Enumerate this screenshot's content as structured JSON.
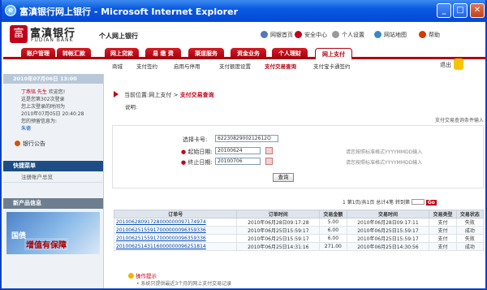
{
  "window": {
    "title": "富滇银行网上银行 - Microsoft Internet Explorer",
    "min": "_",
    "max": "□",
    "close": "✕"
  },
  "header": {
    "logo_cn": "富滇银行",
    "logo_en": "FUDIAN BANK",
    "subtitle": "个人网上银行",
    "links": [
      {
        "label": "网银首页",
        "color": "#5577bb"
      },
      {
        "label": "安全中心",
        "color": "#c1001a"
      },
      {
        "label": "个人设置",
        "color": "#999"
      },
      {
        "label": "网站地图",
        "color": "#3a88c8"
      },
      {
        "label": "帮助",
        "color": "#d43a00"
      }
    ]
  },
  "nav": {
    "tabs": [
      "账户管理",
      "转帐汇款",
      "网上贷款",
      "易 缴 费",
      "渠道服务",
      "资金业务",
      "个人理财",
      "网上支付"
    ],
    "active": 7
  },
  "subnav": {
    "items": [
      "商城",
      "支付签约",
      "启用与停用",
      "支付额度设置",
      "支付交易查询",
      "支付宝卡通签约"
    ],
    "active": 4
  },
  "logout": "退出",
  "sidebar": {
    "date": "2010年07月06日 13:00",
    "user": {
      "name": "丁燕铭 先生",
      "greeting": "欢迎您!",
      "lines": [
        "这是您第302次登录",
        "您上次登录的时间为",
        "2010年07月05日 20:40:28",
        "您的预留信息为:"
      ],
      "reserved": "朱德"
    },
    "notice": "银行公告",
    "menu_title": "快捷菜单",
    "menu_items": [
      "注册账户总览"
    ],
    "news_title": "新产品信息",
    "ad": {
      "line1": "国债",
      "line2": "增值有保障"
    }
  },
  "main": {
    "crumb_prefix": "当前位置:网上支付 >",
    "crumb_current": "支付交易查询",
    "note": "说明:",
    "help": "支付交易查询条件输入",
    "form": {
      "card_label": "选择卡号:",
      "card_value": "6223082900212612O",
      "start_label": "起始日期:",
      "start_value": "20100624",
      "end_label": "终止日期:",
      "end_value": "20100706",
      "hint_start": "请您按照标准格式YYYYMMDD输入",
      "hint_end": "请您按照标准格式YYYYMMDD输入",
      "query": "查询"
    },
    "pager": "1 第1页/共1页 总计4笔 转到第",
    "go": "Go",
    "columns": [
      "订单号",
      "订单时间",
      "交易金额",
      "交易时间",
      "交易类型",
      "交易状态"
    ],
    "rows": [
      [
        "20100628091728000000097174974",
        "2010年06月28日09:17:28",
        "5.00",
        "2010年06月28日09:17:11",
        "支付",
        "失败"
      ],
      [
        "20100625155917000000096359336",
        "2010年06月25日15:59:17",
        "6.00",
        "2010年06月25日15:59:17",
        "支付",
        "成功"
      ],
      [
        "20100625155917000000096359336",
        "2010年06月25日15:59:17",
        "6.00",
        "2010年06月25日15:59:17",
        "支付",
        "失败"
      ],
      [
        "20100625143116000000096251814",
        "2010年06月25日14:31:16",
        "271.00",
        "2010年06月25日14:30:56",
        "支付",
        "成功"
      ]
    ],
    "tip_title": "操作提示",
    "tip_text": "系统只提供最近3个月的网上支付交易记录"
  }
}
